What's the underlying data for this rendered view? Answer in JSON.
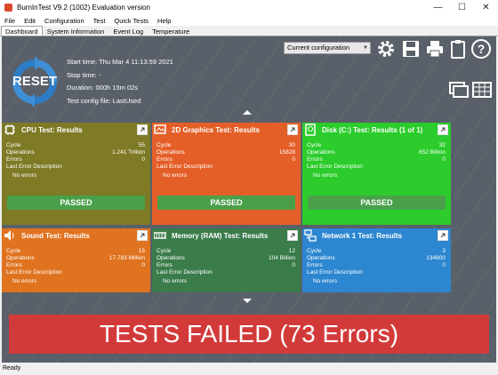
{
  "window": {
    "title": "BurnInTest V9.2 (1002) Evaluation version"
  },
  "menu": [
    "File",
    "Edit",
    "Configuration",
    "Test",
    "Quick Tests",
    "Help"
  ],
  "tabs": [
    "Dashboard",
    "System Information",
    "Event Log",
    "Temperature"
  ],
  "reset": {
    "label": "RESET"
  },
  "info": {
    "start": "Start time: Thu Mar  4 11:13:59 2021",
    "stop": "Stop time: -",
    "duration": "Duration: 000h 15m 02s",
    "config_file": "Test config file: LastUsed"
  },
  "config_select": {
    "value": "Current configuration"
  },
  "colors": {
    "cpu": "#7e7a26",
    "graphics": "#e45f28",
    "disk": "#2bcc2b",
    "sound": "#e0731f",
    "memory": "#3a7c4a",
    "network": "#2c86d0",
    "passed_bg": "#4aa04a",
    "fail_bg": "#d23a3a"
  },
  "row_labels": {
    "cycle": "Cycle",
    "operations": "Operations",
    "errors": "Errors",
    "last_error": "Last Error Description"
  },
  "tiles": [
    {
      "title": "CPU Test: Results",
      "icon": "cpu-icon",
      "cycle": "55",
      "operations": "1.241 Trillion",
      "errors": "0",
      "last_error": "No errors",
      "status": "PASSED"
    },
    {
      "title": "2D Graphics Test: Results",
      "icon": "graphics-icon",
      "cycle": "30",
      "operations": "15828",
      "errors": "0",
      "last_error": "No errors",
      "status": "PASSED"
    },
    {
      "title": "Disk (C:) Test: Results (1 of 1)",
      "icon": "disk-icon",
      "cycle": "32",
      "operations": "652 Billion",
      "errors": "0",
      "last_error": "No errors",
      "status": "PASSED"
    },
    {
      "title": "Sound Test: Results",
      "icon": "speaker-icon",
      "cycle": "15",
      "operations": "17.783 Million",
      "errors": "0",
      "last_error": "No errors"
    },
    {
      "title": "Memory (RAM) Test: Results",
      "icon": "memory-icon",
      "cycle": "12",
      "operations": "104 Billion",
      "errors": "0",
      "last_error": "No errors"
    },
    {
      "title": "Network 1 Test: Results",
      "icon": "network-icon",
      "cycle": "3",
      "operations": "134800",
      "errors": "0",
      "last_error": "No errors"
    }
  ],
  "fail_banner": {
    "text": "TESTS FAILED (73 Errors)"
  },
  "status_bar": {
    "text": "Ready"
  }
}
